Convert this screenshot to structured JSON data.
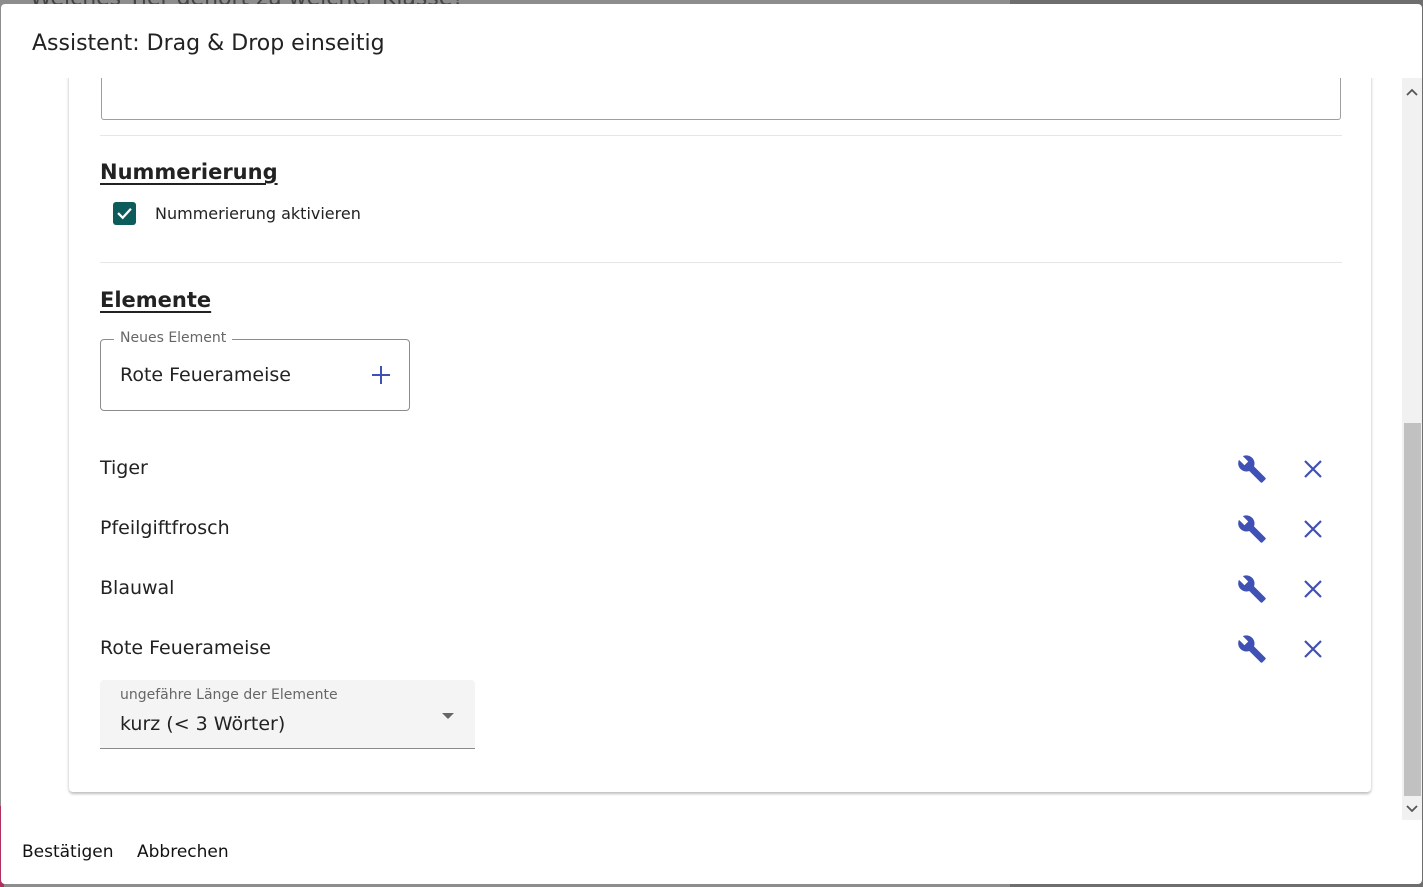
{
  "dialog": {
    "title": "Assistent: Drag & Drop einseitig"
  },
  "background": {
    "peek_text": "Welches Tier gehört zu welcher Klasse?"
  },
  "numbering": {
    "heading": "Nummerierung",
    "checkbox_label": "Nummerierung aktivieren",
    "checked": true
  },
  "elements": {
    "heading": "Elemente",
    "new_element_label": "Neues Element",
    "new_element_value": "Rote Feuerameise",
    "items": [
      {
        "label": "Tiger"
      },
      {
        "label": "Pfeilgiftfrosch"
      },
      {
        "label": "Blauwal"
      },
      {
        "label": "Rote Feuerameise"
      }
    ],
    "length_select_label": "ungefähre Länge der Elemente",
    "length_select_value": "kurz (< 3 Wörter)"
  },
  "actions": {
    "confirm_label": "Bestätigen",
    "cancel_label": "Abbrechen"
  },
  "colors": {
    "accent": "#3f51b5",
    "checkbox": "#0d5c5c"
  }
}
